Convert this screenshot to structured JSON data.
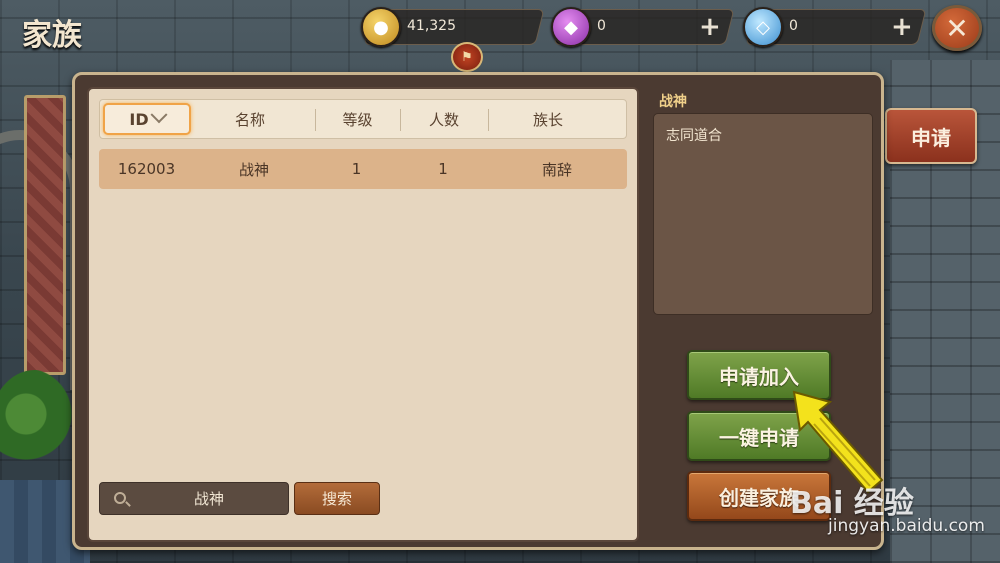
{
  "window": {
    "title": "家族"
  },
  "resources": [
    {
      "icon": "gold-coin-icon",
      "value": "41,325"
    },
    {
      "icon": "purple-gem-icon",
      "value": "0",
      "plus": "+"
    },
    {
      "icon": "diamond-icon",
      "value": "0",
      "plus": "+"
    }
  ],
  "close": {
    "icon": "close-icon",
    "label": "✕"
  },
  "table": {
    "columns": [
      "ID",
      "名称",
      "等级",
      "人数",
      "族长"
    ],
    "rows": [
      {
        "id": "162003",
        "name": "战神",
        "level": "1",
        "members": "1",
        "leader": "南辞"
      }
    ]
  },
  "search": {
    "value": "战神",
    "button": "搜索"
  },
  "detail": {
    "name": "战神",
    "description": "志同道合"
  },
  "buttons": {
    "apply_join": "申请加入",
    "one_click_apply": "一键申请",
    "create_family": "创建家族",
    "apply_tab": "申请"
  },
  "watermark": {
    "logo": "Bai 经验",
    "url": "jingyan.baidu.com"
  },
  "colors": {
    "accent_green": "#5f8a30",
    "accent_orange": "#b0602a",
    "panel_bg": "#e6d6bf",
    "selected_row": "#dcb38a"
  }
}
